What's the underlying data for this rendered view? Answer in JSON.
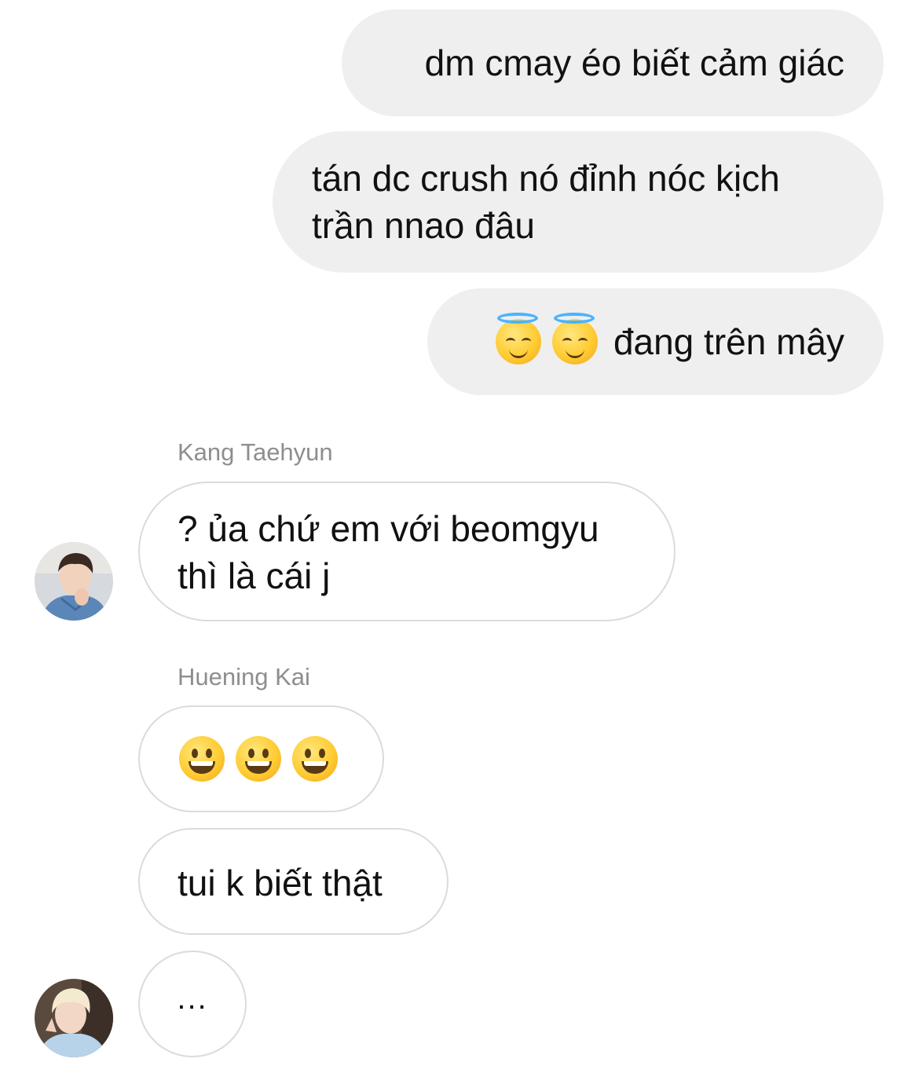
{
  "messages": {
    "outgoing": [
      {
        "text": "dm cmay éo biết cảm giác"
      },
      {
        "line1": "tán dc crush nó đỉnh nóc kịch",
        "line2": "trần nnao đâu"
      },
      {
        "emoji": [
          "smiling-face-with-halo",
          "smiling-face-with-halo"
        ],
        "text": "đang trên mây"
      }
    ],
    "incoming": [
      {
        "sender": "Kang Taehyun",
        "line1": "? ủa chứ em với beomgyu",
        "line2": "thì là cái j"
      },
      {
        "sender": "Huening Kai",
        "emoji": [
          "grinning-face",
          "grinning-face",
          "grinning-face"
        ],
        "text2": "tui k biết thật",
        "typing": "..."
      }
    ]
  },
  "colors": {
    "outgoing_bubble": "#efefef",
    "incoming_border": "#dbdbdb",
    "sender_name": "#8e8e8e"
  }
}
